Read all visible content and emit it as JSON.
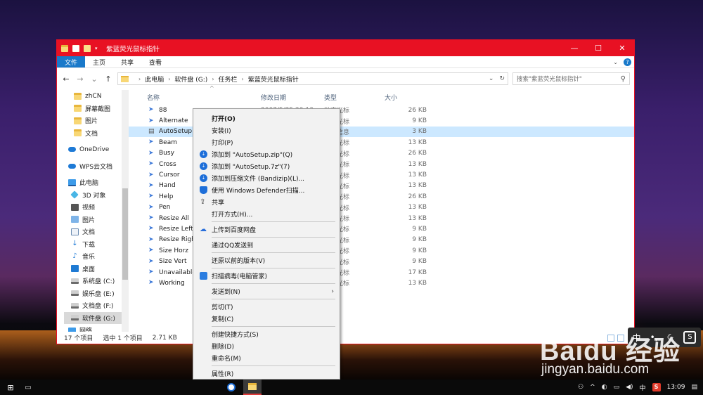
{
  "window": {
    "title": "紫蓝荧光鼠标指针",
    "accent": "#e81123",
    "ribbon_tabs": [
      "文件",
      "主页",
      "共享",
      "查看"
    ],
    "controls": {
      "minimize": "—",
      "maximize": "☐",
      "close": "✕"
    }
  },
  "address": {
    "crumbs": [
      "此电脑",
      "软件盘 (G:)",
      "任务栏",
      "紫蓝荧光鼠标指针"
    ],
    "search_placeholder": "搜索\"紫蓝荧光鼠标指针\""
  },
  "nav": {
    "items": [
      {
        "label": "zhCN",
        "icon": "folder-icon"
      },
      {
        "label": "屏幕截图",
        "icon": "folder-icon"
      },
      {
        "label": "图片",
        "icon": "folder-icon"
      },
      {
        "label": "文档",
        "icon": "folder-icon"
      },
      {
        "label": "",
        "icon": ""
      },
      {
        "label": "OneDrive",
        "icon": "onedrive-icon"
      },
      {
        "label": "",
        "icon": ""
      },
      {
        "label": "WPS云文档",
        "icon": "cloud-icon"
      },
      {
        "label": "",
        "icon": ""
      },
      {
        "label": "此电脑",
        "icon": "pc-icon"
      },
      {
        "label": "3D 对象",
        "icon": "3d-objects-icon"
      },
      {
        "label": "视频",
        "icon": "video-icon"
      },
      {
        "label": "图片",
        "icon": "pictures-icon"
      },
      {
        "label": "文档",
        "icon": "documents-icon"
      },
      {
        "label": "下载",
        "icon": "download-icon"
      },
      {
        "label": "音乐",
        "icon": "music-icon"
      },
      {
        "label": "桌面",
        "icon": "desktop-icon"
      },
      {
        "label": "系统盘 (C:)",
        "icon": "drive-icon"
      },
      {
        "label": "娱乐盘 (E:)",
        "icon": "drive-icon"
      },
      {
        "label": "文档盘 (F:)",
        "icon": "drive-icon"
      },
      {
        "label": "软件盘 (G:)",
        "icon": "drive-icon"
      },
      {
        "label": "网络",
        "icon": "network-icon"
      }
    ]
  },
  "files": {
    "headers": {
      "name": "名称",
      "date": "修改日期",
      "type": "类型",
      "size": "大小"
    },
    "rows": [
      {
        "name": "88",
        "date": "2007/5/25 20:13",
        "type": "动态光标",
        "size": "26 KB"
      },
      {
        "name": "Alternate",
        "date": "",
        "type": "动态光标",
        "size": "9 KB"
      },
      {
        "name": "AutoSetup",
        "date": "",
        "type": "安装信息",
        "size": "3 KB"
      },
      {
        "name": "Beam",
        "date": "",
        "type": "动态光标",
        "size": "13 KB"
      },
      {
        "name": "Busy",
        "date": "",
        "type": "动态光标",
        "size": "26 KB"
      },
      {
        "name": "Cross",
        "date": "",
        "type": "动态光标",
        "size": "13 KB"
      },
      {
        "name": "Cursor",
        "date": "",
        "type": "动态光标",
        "size": "13 KB"
      },
      {
        "name": "Hand",
        "date": "",
        "type": "动态光标",
        "size": "13 KB"
      },
      {
        "name": "Help",
        "date": "",
        "type": "动态光标",
        "size": "26 KB"
      },
      {
        "name": "Pen",
        "date": "",
        "type": "动态光标",
        "size": "13 KB"
      },
      {
        "name": "Resize All",
        "date": "",
        "type": "动态光标",
        "size": "13 KB"
      },
      {
        "name": "Resize Left",
        "date": "",
        "type": "动态光标",
        "size": "9 KB"
      },
      {
        "name": "Resize Right",
        "date": "",
        "type": "动态光标",
        "size": "9 KB"
      },
      {
        "name": "Size Horz",
        "date": "",
        "type": "动态光标",
        "size": "9 KB"
      },
      {
        "name": "Size Vert",
        "date": "",
        "type": "动态光标",
        "size": "9 KB"
      },
      {
        "name": "Unavailable",
        "date": "",
        "type": "动态光标",
        "size": "17 KB"
      },
      {
        "name": "Working",
        "date": "",
        "type": "动态光标",
        "size": "13 KB"
      }
    ]
  },
  "status": {
    "count": "17 个项目",
    "selected": "选中 1 个项目",
    "size": "2.71 KB"
  },
  "context_menu": {
    "items": [
      {
        "label": "打开(O)",
        "bold": true,
        "icon": ""
      },
      {
        "label": "安装(I)",
        "icon": ""
      },
      {
        "label": "打印(P)",
        "icon": ""
      },
      {
        "label": "添加到 \"AutoSetup.zip\"(Q)",
        "icon": "bandizip-icon"
      },
      {
        "label": "添加到 \"AutoSetup.7z\"(7)",
        "icon": "bandizip-icon"
      },
      {
        "label": "添加到压缩文件 (Bandizip)(L)...",
        "icon": "bandizip-icon"
      },
      {
        "label": "使用 Windows Defender扫描...",
        "icon": "defender-icon"
      },
      {
        "label": "共享",
        "icon": "share-icon"
      },
      {
        "label": "打开方式(H)...",
        "icon": ""
      },
      {
        "sep": true
      },
      {
        "label": "上传到百度网盘",
        "icon": "baidu-cloud-icon"
      },
      {
        "sep": true
      },
      {
        "label": "通过QQ发送到",
        "icon": ""
      },
      {
        "sep": true
      },
      {
        "label": "还原以前的版本(V)",
        "icon": ""
      },
      {
        "sep": true
      },
      {
        "label": "扫描病毒(电脑管家)",
        "icon": "pc-manager-icon"
      },
      {
        "sep": true
      },
      {
        "label": "发送到(N)",
        "icon": "",
        "submenu": true
      },
      {
        "sep": true
      },
      {
        "label": "剪切(T)",
        "icon": ""
      },
      {
        "label": "复制(C)",
        "icon": ""
      },
      {
        "sep": true
      },
      {
        "label": "创建快捷方式(S)",
        "icon": ""
      },
      {
        "label": "删除(D)",
        "icon": ""
      },
      {
        "label": "重命名(M)",
        "icon": ""
      },
      {
        "sep": true
      },
      {
        "label": "属性(R)",
        "icon": ""
      }
    ]
  },
  "taskbar": {
    "time": "13:09",
    "ime": "中"
  },
  "ime_bar": {
    "lang": "中"
  },
  "watermark": {
    "logo": "Baidu 经验",
    "url": "jingyan.baidu.com"
  }
}
